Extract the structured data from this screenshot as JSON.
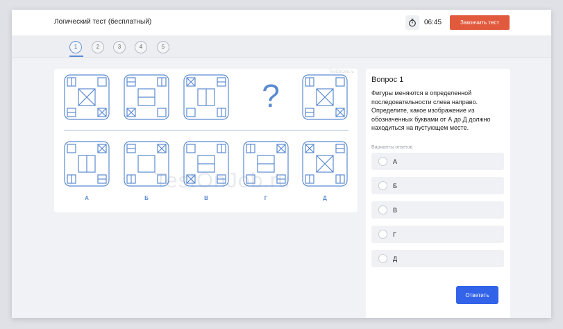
{
  "header": {
    "title": "Логический тест (бесплатный)",
    "timer_icon": "stopwatch-icon",
    "time": "06:45",
    "finish_label": "Закончить тест"
  },
  "steps": [
    "1",
    "2",
    "3",
    "4",
    "5"
  ],
  "active_step": "1",
  "puzzle": {
    "question_mark": "?",
    "option_labels": [
      "А",
      "Б",
      "В",
      "Г",
      "Д"
    ],
    "watermark": "TestOnJob.ru",
    "mini_watermark": "TestOnJob.ru"
  },
  "question": {
    "title": "Вопрос 1",
    "text": "Фигуры меняются в определенной последовательности слева направо. Определите, какое изображение из обозначенных буквами от А до Д должно находиться на пустующем месте.",
    "answers_label": "Варианты ответов",
    "answers": [
      "А",
      "Б",
      "В",
      "Г",
      "Д"
    ],
    "submit_label": "Ответить"
  },
  "colors": {
    "accent": "#3263e8",
    "finish": "#e25a3e",
    "figure_stroke": "#5b8ad0"
  }
}
